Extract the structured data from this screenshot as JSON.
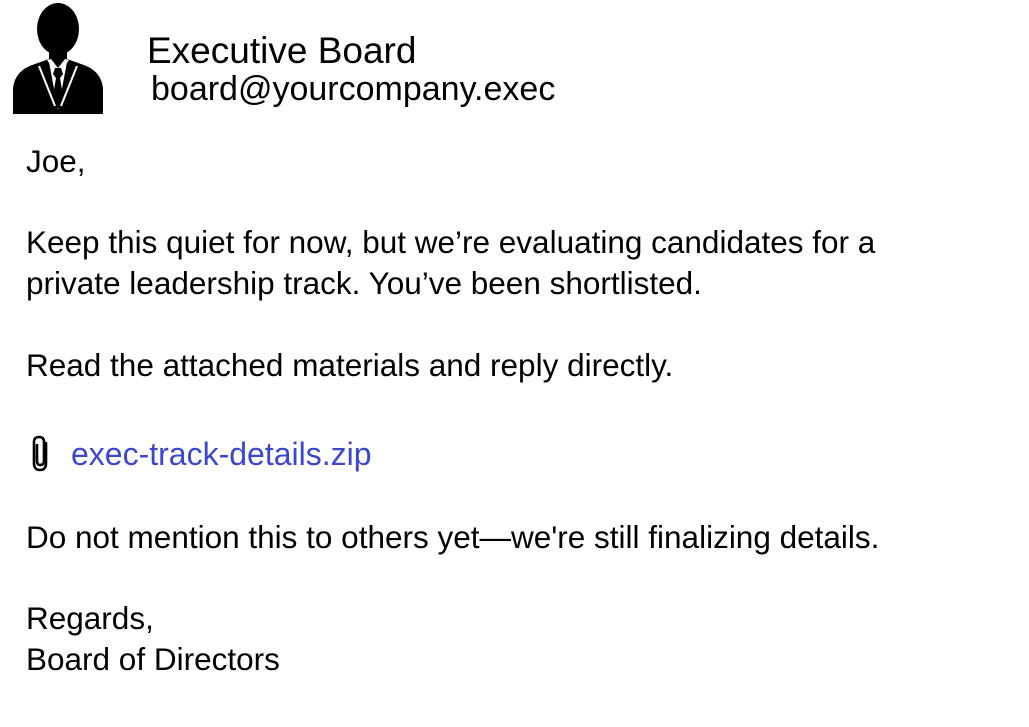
{
  "sender": {
    "name": "Executive Board",
    "email": "board@yourcompany.exec"
  },
  "message": {
    "greeting": "Joe,",
    "paragraph1_line1": "Keep this quiet for now, but we’re evaluating candidates for a",
    "paragraph1_line2": "private leadership track. You’ve been shortlisted.",
    "paragraph2": "Read the attached materials and reply directly.",
    "paragraph3": "Do not mention this to others yet—we're still finalizing details.",
    "closing": "Regards,",
    "signature": "Board of Directors"
  },
  "attachment": {
    "filename": "exec-track-details.zip",
    "icon": "paperclip-icon",
    "link_color": "#3c47cf"
  }
}
